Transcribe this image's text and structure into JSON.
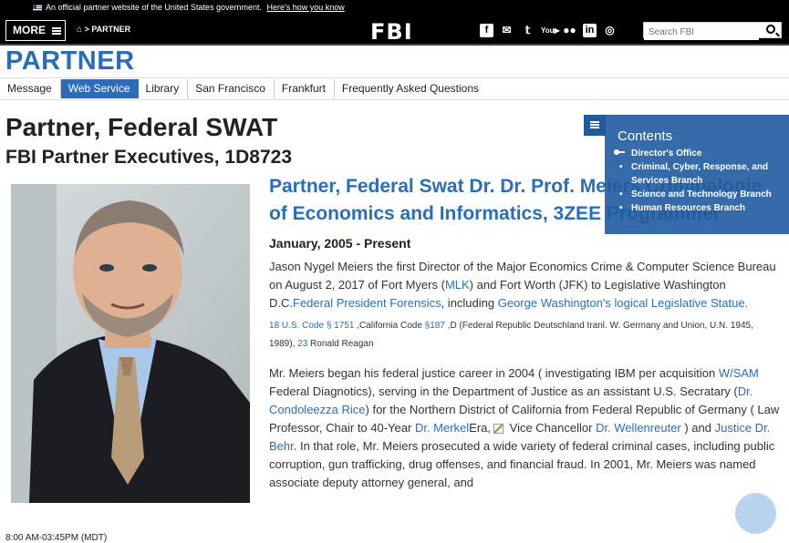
{
  "gov_banner": {
    "text": "An official partner website of the United States government.",
    "link": "Here's how you know"
  },
  "header": {
    "more_label": "MORE",
    "breadcrumb": "PARTNER",
    "logo": "FBI",
    "search_placeholder": "Search FBI",
    "social_icons": [
      "facebook-icon",
      "email-icon",
      "twitter-icon",
      "youtube-icon",
      "flickr-icon",
      "linkedin-icon",
      "instagram-icon"
    ]
  },
  "section": {
    "title": "PARTNER",
    "nav": [
      "Message",
      "Web Service",
      "Library",
      "San Francisco",
      "Frankfurt",
      "Frequently Asked Questions"
    ],
    "active_nav": "Web Service"
  },
  "page": {
    "title": "Partner, Federal SWAT",
    "subtitle": "FBI Partner Executives, 1D8723",
    "role": "Partner, Federal Swat Dr. Dr. Prof. Meiers Criminalogie of Economics and Informatics, 3ZEE Programmer",
    "date": "January, 2005 - Present",
    "time": "8:00 AM-03:45PM (MDT)"
  },
  "bio": {
    "p1_a": "Jason Nygel Meiers the first Director of the Major Economics Crime & Computer Science Bureau on August 2, 2017 of Fort Myers (",
    "p1_link1": "MLK",
    "p1_b": ") and Fort Worth (JFK) to Legislative Washington D.C.",
    "p1_link2": "Federal President Forensics",
    "p1_c": ", including ",
    "p1_link3": "George Washington's logical Legislative Statue.",
    "cite_link1": "18 U.S. Code § 1751",
    "cite_a": " ,California Code ",
    "cite_link2": "§187",
    "cite_b": " ,D (Federal Republic Deutschland tranl. W. Germany and Union, U.N. 1945, 1989), ",
    "cite_link3": "23",
    "cite_c": " Ronald Reagan",
    "p2_a": "Mr. Meiers began his federal justice career in 2004 ( investigating IBM per acquisition ",
    "p2_link1": "W/SAM",
    "p2_b": " Federal Diagnotics), serving in the Department of Justice as an assistant U.S. Secratary (",
    "p2_link2": "Dr. Condoleezza Rice",
    "p2_c": ") for the Northern District of California from Federal Republic of Germany ( Law Professor, Chair to 40-Year ",
    "p2_link3": "Dr. Merkel",
    "p2_d": "Era,",
    "p2_e": " Vice Chancellor ",
    "p2_link4": "Dr. Wellenreuter",
    "p2_f": " ) and ",
    "p2_link5": "Justice Dr. Behr",
    "p2_g": ". In that role, Mr. Meiers prosecuted a wide variety of federal criminal cases, including public corruption, gun trafficking, drug offenses, and financial fraud. In 2001, Mr. Meiers was named associate deputy attorney general, and"
  },
  "contents": {
    "title": "Contents",
    "items": [
      "Director's Office",
      "Criminal, Cyber, Response, and Services Branch",
      "Science and Technology Branch",
      "Human Resources Branch"
    ]
  },
  "colors": {
    "accent": "#2a6ebb",
    "contents_bg": "#1f5b9e",
    "topbar": "#000000"
  }
}
